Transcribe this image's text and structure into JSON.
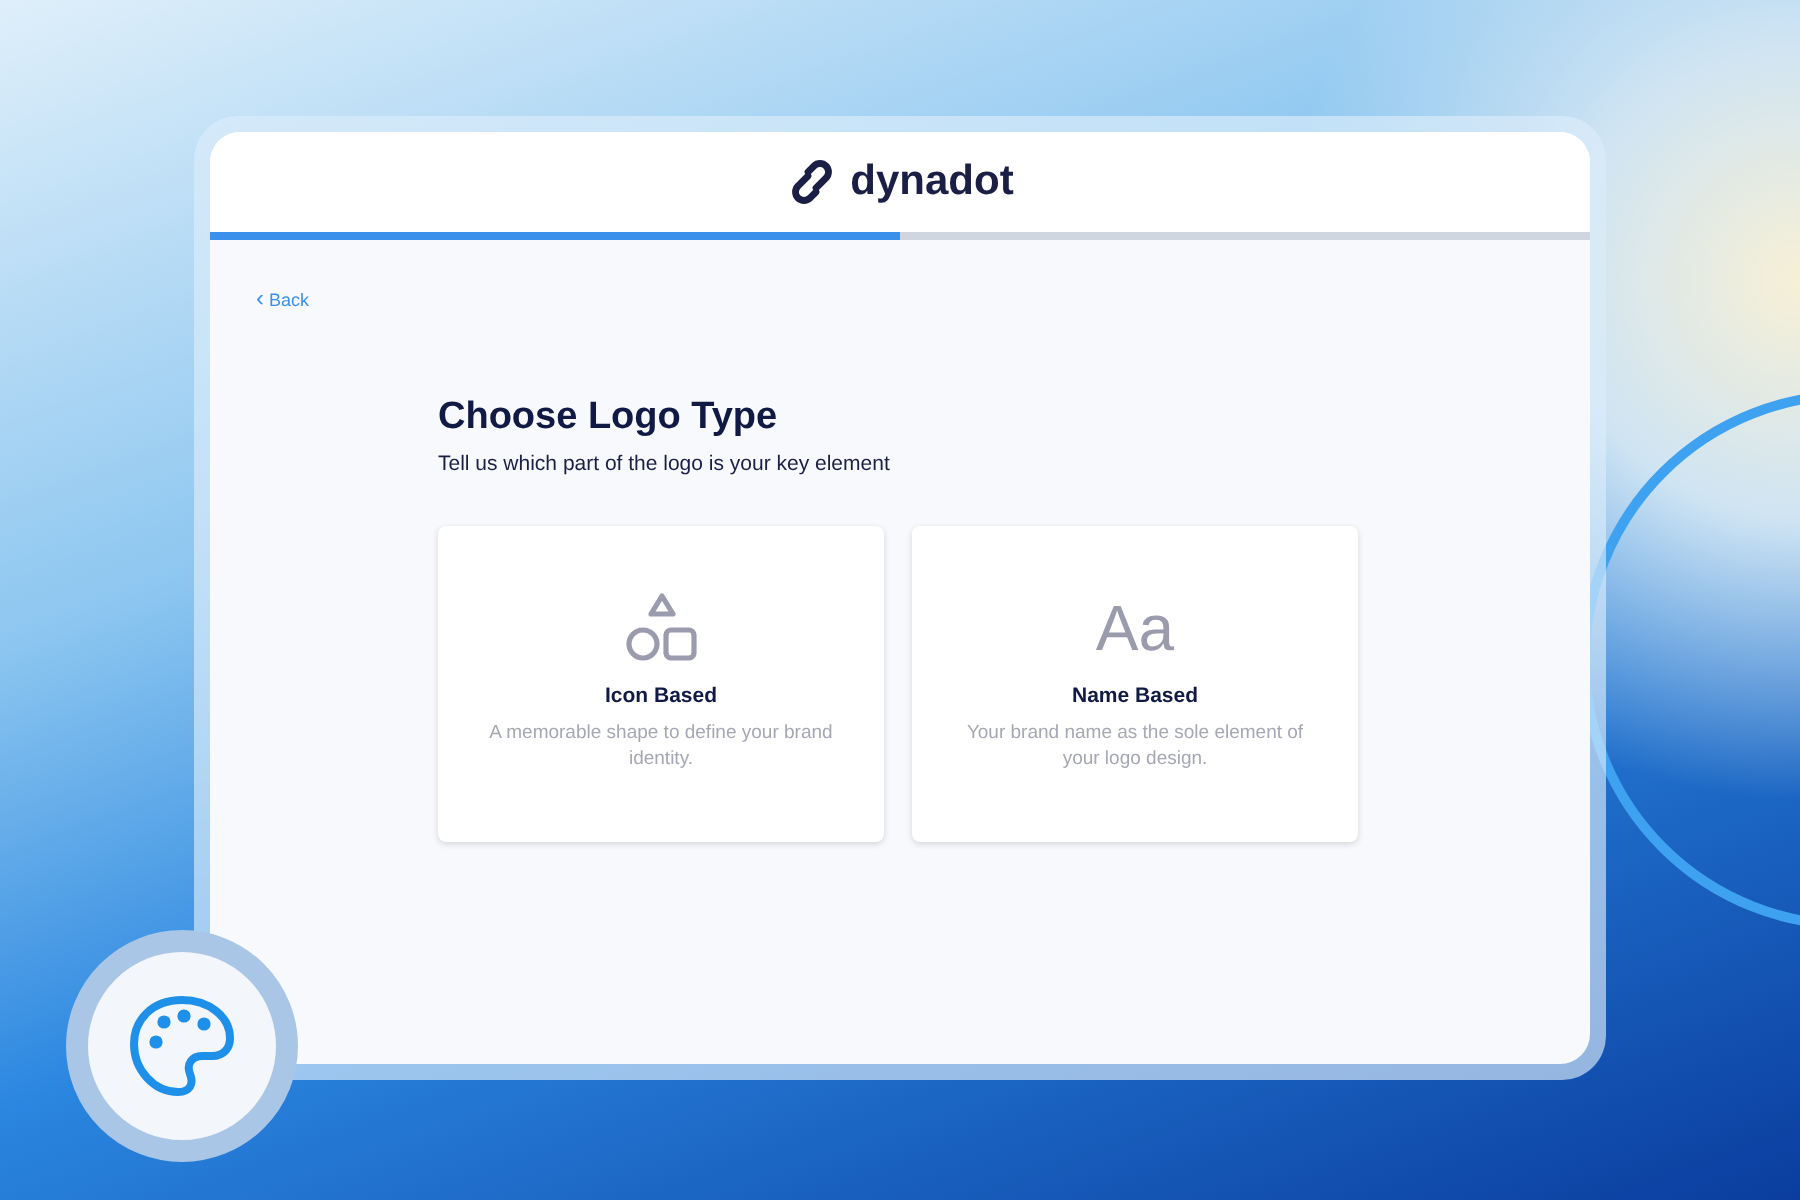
{
  "header": {
    "logo_text": "dynadot"
  },
  "progress": {
    "level": 0.5
  },
  "back_link": {
    "icon": "‹",
    "label": "Back"
  },
  "title": "Choose Logo Type",
  "subtitle": "Tell us which part of the logo is your key element",
  "options": [
    {
      "kind": "shapes",
      "title": "Icon Based",
      "description": "A memorable shape to define your brand identity."
    },
    {
      "kind": "glyph",
      "glyph": "Aa",
      "title": "Name Based",
      "description": "Your brand name as the sole element of your logo design."
    }
  ]
}
